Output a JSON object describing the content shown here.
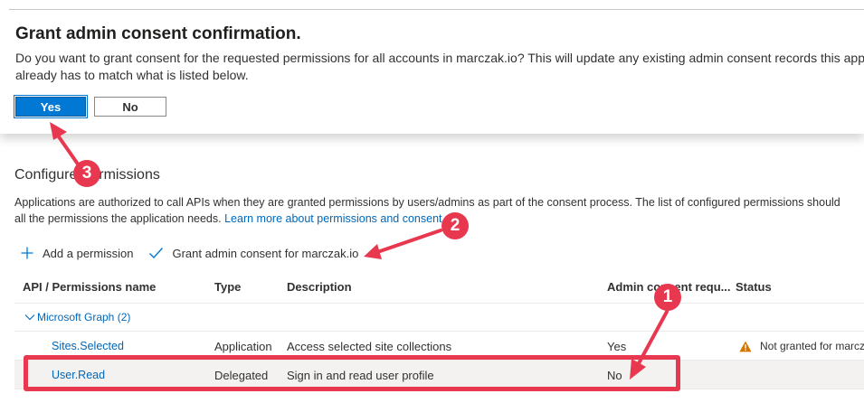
{
  "confirm": {
    "title": "Grant admin consent confirmation.",
    "message_line1": "Do you want to grant consent for the requested permissions for all accounts in marczak.io? This will update any existing admin consent records this appl",
    "message_line2": "already has to match what is listed below.",
    "yes_label": "Yes",
    "no_label": "No"
  },
  "permissions": {
    "title_before": "Configure",
    "title_after": "ermissions",
    "desc_line1": "Applications are authorized to call APIs when they are granted permissions by users/admins as part of the consent process. The list of configured permissions should",
    "desc_line2_text": "all the permissions the application needs. ",
    "desc_line2_link": "Learn more about permissions and consent"
  },
  "toolbar": {
    "add_label": "Add a permission",
    "grant_label": "Grant admin consent for marczak.io"
  },
  "table": {
    "headers": {
      "api": "API / Permissions name",
      "type": "Type",
      "description": "Description",
      "admin": "Admin consent requ...",
      "status": "Status"
    },
    "group": "Microsoft Graph (2)",
    "rows": [
      {
        "name": "Sites.Selected",
        "type": "Application",
        "description": "Access selected site collections",
        "admin": "Yes",
        "status": "Not granted for marcz"
      },
      {
        "name": "User.Read",
        "type": "Delegated",
        "description": "Sign in and read user profile",
        "admin": "No",
        "status": ""
      }
    ]
  },
  "annotations": {
    "badge_1": "1",
    "badge_2": "2",
    "badge_3": "3"
  },
  "colors": {
    "accent": "#0078d4",
    "link": "#0067b8",
    "annotation": "#e8384f",
    "warning": "#d47500"
  },
  "icons": {
    "add": "plus-icon",
    "grant": "checkmark-icon",
    "group": "chevron-down-icon",
    "status": "warning-icon"
  }
}
